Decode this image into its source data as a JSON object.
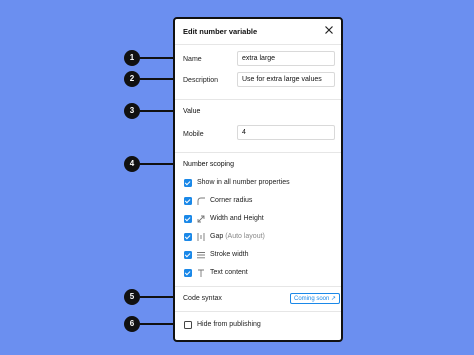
{
  "dialog": {
    "title": "Edit number variable",
    "close_icon": "close-icon",
    "name_label": "Name",
    "name_value": "extra large",
    "description_label": "Description",
    "description_value": "Use for extra large values",
    "value_section": "Value",
    "mobile_label": "Mobile",
    "mobile_value": "4",
    "scoping_section": "Number scoping",
    "scopes": [
      {
        "label": "Show in all number properties",
        "checked": true,
        "icon": ""
      },
      {
        "label": "Corner radius",
        "checked": true,
        "icon": "corner-radius-icon"
      },
      {
        "label": "Width and Height",
        "checked": true,
        "icon": "resize-icon"
      },
      {
        "label": "Gap",
        "sublabel": "(Auto layout)",
        "checked": true,
        "icon": "gap-icon"
      },
      {
        "label": "Stroke width",
        "checked": true,
        "icon": "stroke-icon"
      },
      {
        "label": "Text content",
        "checked": true,
        "icon": "text-icon"
      }
    ],
    "code_syntax_label": "Code syntax",
    "coming_soon_badge": "Coming soon",
    "hide_label": "Hide from publishing",
    "hide_checked": false
  },
  "markers": [
    "1",
    "2",
    "3",
    "4",
    "5",
    "6"
  ],
  "colors": {
    "background": "#6b8ff0",
    "accent": "#1a88e8",
    "marker": "#111111"
  }
}
